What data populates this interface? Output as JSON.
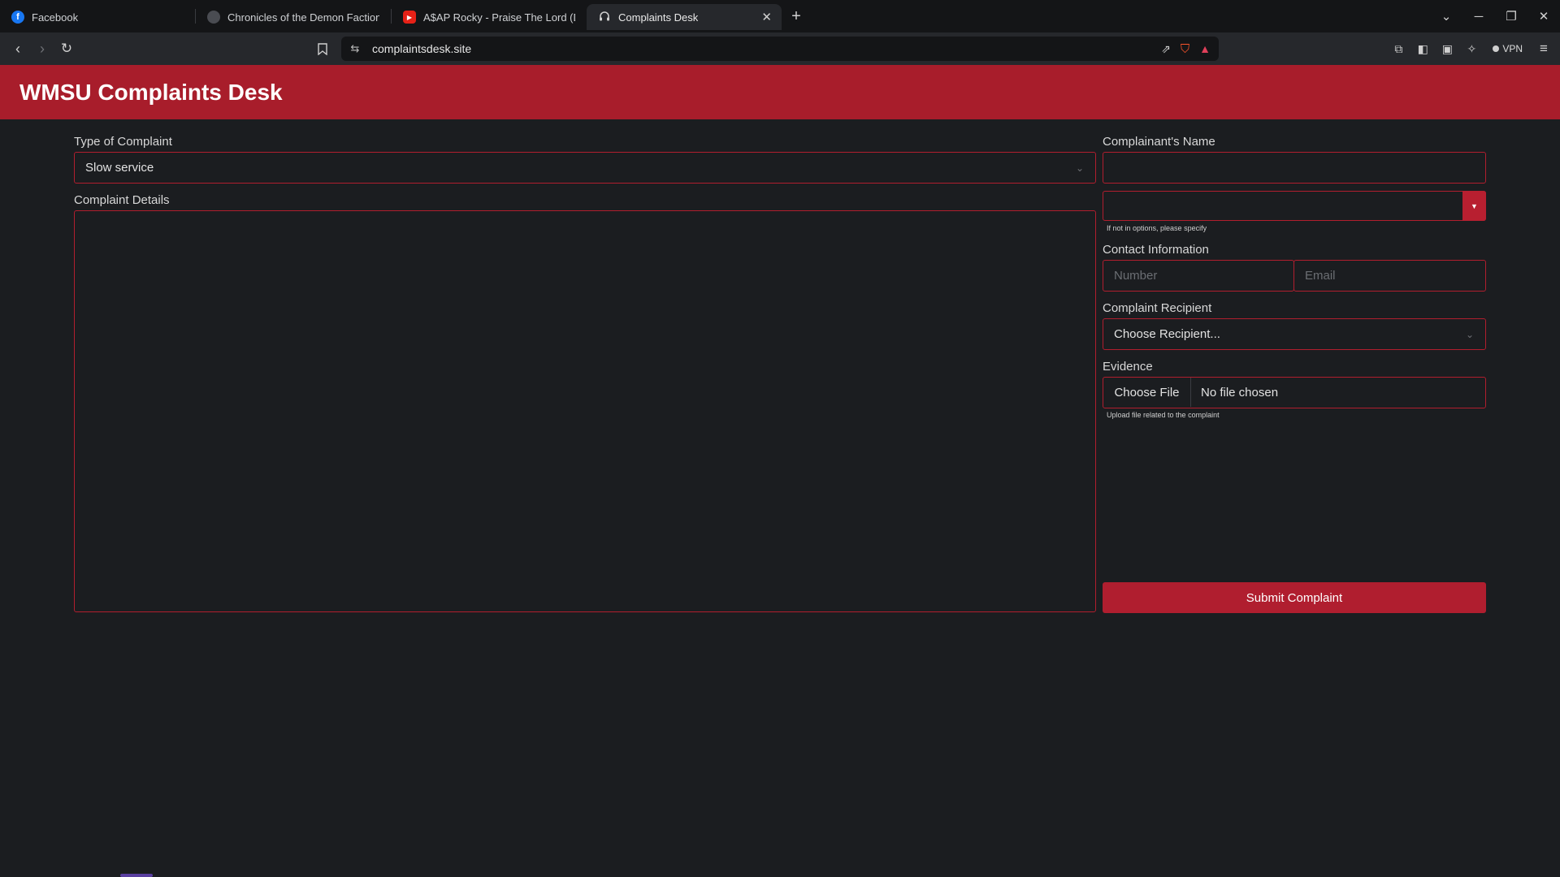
{
  "browser": {
    "tabs": [
      {
        "label": "Facebook",
        "icon": "facebook-icon",
        "icon_color": "#1877f2",
        "active": false
      },
      {
        "label": "Chronicles of the Demon Faction C",
        "icon": "globe-icon",
        "icon_color": "#4a4c52",
        "active": false
      },
      {
        "label": "A$AP Rocky - Praise The Lord (Da S",
        "icon": "youtube-icon",
        "icon_color": "#e62117",
        "active": false
      },
      {
        "label": "Complaints Desk",
        "icon": "headset-icon",
        "icon_color": "#d0d0d0",
        "active": true
      }
    ],
    "url": "complaintsdesk.site",
    "vpn_label": "VPN"
  },
  "page": {
    "title": "WMSU Complaints Desk",
    "accent_color": "#a81d2b"
  },
  "form": {
    "type_label": "Type of Complaint",
    "type_value": "Slow service",
    "details_label": "Complaint Details",
    "details_value": "",
    "name_label": "Complainant's Name",
    "name_value": "",
    "specify_value": "",
    "specify_hint": "If not in options, please specify",
    "contact_label": "Contact Information",
    "number_placeholder": "Number",
    "email_placeholder": "Email",
    "recipient_label": "Complaint Recipient",
    "recipient_value": "Choose Recipient...",
    "evidence_label": "Evidence",
    "file_button_label": "Choose File",
    "file_status": "No file chosen",
    "evidence_hint": "Upload file related to the complaint",
    "submit_label": "Submit Complaint"
  }
}
